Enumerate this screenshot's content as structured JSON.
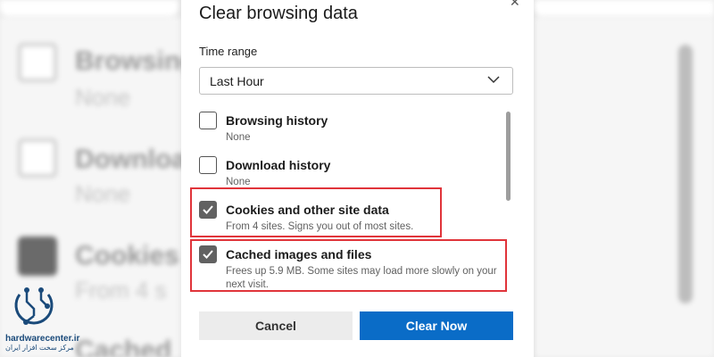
{
  "dialog": {
    "title": "Clear browsing data",
    "close_icon": "close-icon",
    "time_range": {
      "label": "Time range",
      "value": "Last Hour"
    },
    "items": [
      {
        "title": "Browsing history",
        "description": "None",
        "checked": false
      },
      {
        "title": "Download history",
        "description": "None",
        "checked": false
      },
      {
        "title": "Cookies and other site data",
        "description": "From 4 sites. Signs you out of most sites.",
        "checked": true,
        "highlighted": true
      },
      {
        "title": "Cached images and files",
        "description": "Frees up 5.9 MB. Some sites may load more slowly on your next visit.",
        "checked": true,
        "highlighted": true
      }
    ],
    "buttons": {
      "cancel": "Cancel",
      "clear": "Clear Now"
    }
  },
  "background": {
    "items": [
      {
        "title": "Browsing",
        "description": "None"
      },
      {
        "title": "Download",
        "description": "None"
      },
      {
        "title": "Cookies",
        "description": "From 4 s"
      },
      {
        "title": "Cached",
        "description": ""
      }
    ]
  },
  "logo": {
    "name": "hardwarecenter.ir",
    "tagline": "مرکز سخت افزار ایران"
  },
  "colors": {
    "accent": "#0a6cc7",
    "highlight": "#e0343a",
    "checkbox_checked": "#616161"
  }
}
